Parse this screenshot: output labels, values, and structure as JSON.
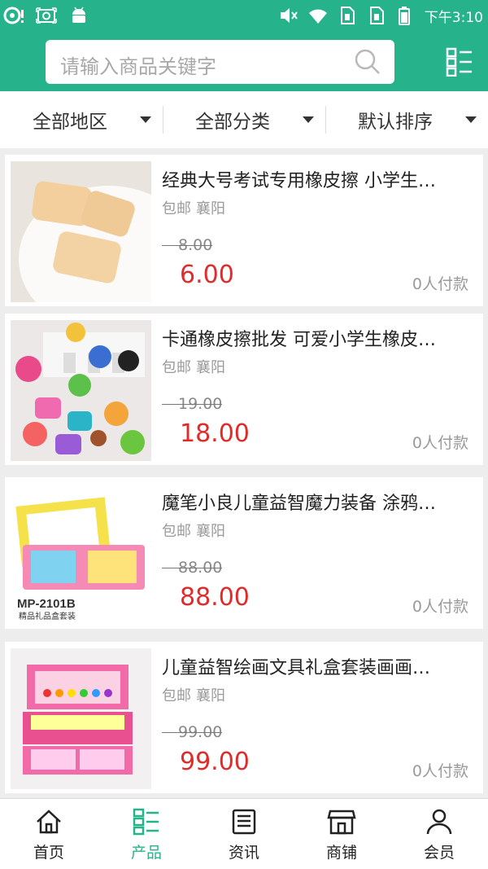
{
  "status_bar": {
    "time": "下午3:10",
    "icons": [
      "notification-icon",
      "screenshot-icon",
      "android-icon",
      "mute-icon",
      "wifi-icon",
      "sim1-icon",
      "sim2-icon",
      "battery-icon"
    ]
  },
  "search": {
    "placeholder": "请输入商品关键字"
  },
  "filters": [
    {
      "label": "全部地区"
    },
    {
      "label": "全部分类"
    },
    {
      "label": "默认排序"
    }
  ],
  "products": [
    {
      "title": "经典大号考试专用橡皮擦 小学生…",
      "tag": "包邮",
      "location": "襄阳",
      "old_price": "8.00",
      "price": "6.00",
      "paid": "0人付款",
      "image": "eraser-photo"
    },
    {
      "title": "卡通橡皮擦批发 可爱小学生橡皮…",
      "tag": "包邮",
      "location": "襄阳",
      "old_price": "19.00",
      "price": "18.00",
      "paid": "0人付款",
      "image": "cartoon-eraser-photo"
    },
    {
      "title": "魔笔小良儿童益智魔力装备 涂鸦…",
      "tag": "包邮",
      "location": "襄阳",
      "old_price": "88.00",
      "price": "88.00",
      "paid": "0人付款",
      "image": "drawing-board-photo",
      "image_text": [
        "MP-2101B",
        "精品礼品盒套装"
      ]
    },
    {
      "title": "儿童益智绘画文具礼盒套装画画…",
      "tag": "包邮",
      "location": "襄阳",
      "old_price": "99.00",
      "price": "99.00",
      "paid": "0人付款",
      "image": "art-set-photo"
    }
  ],
  "nav": [
    {
      "label": "首页",
      "icon": "home-icon",
      "active": false
    },
    {
      "label": "产品",
      "icon": "product-list-icon",
      "active": true
    },
    {
      "label": "资讯",
      "icon": "news-icon",
      "active": false
    },
    {
      "label": "商铺",
      "icon": "shop-icon",
      "active": false
    },
    {
      "label": "会员",
      "icon": "member-icon",
      "active": false
    }
  ],
  "colors": {
    "accent": "#26b38b",
    "price": "#e02b2b"
  }
}
